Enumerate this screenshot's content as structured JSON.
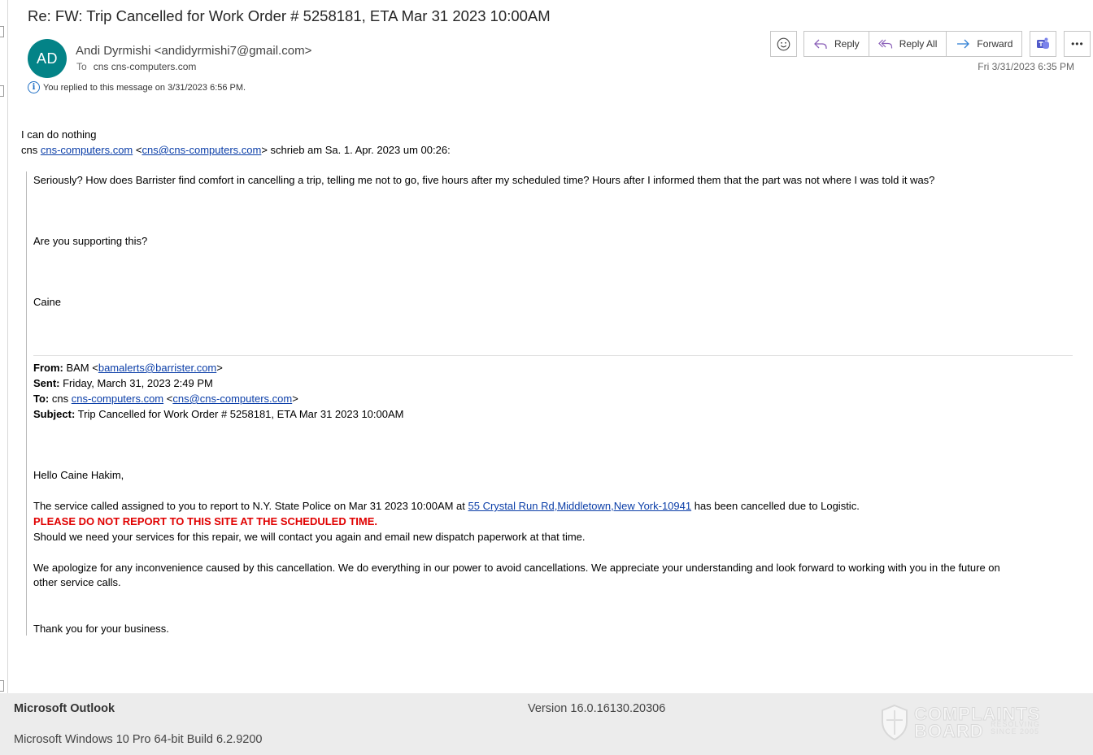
{
  "message": {
    "subject": "Re: FW: Trip Cancelled for Work Order # 5258181, ETA Mar 31 2023 10:00AM",
    "avatar_initials": "AD",
    "sender": "Andi Dyrmishi <andidyrmishi7@gmail.com>",
    "to_label": "To",
    "to_value": "cns cns-computers.com",
    "info_text": "You replied to this message on 3/31/2023 6:56 PM.",
    "date": "Fri 3/31/2023 6:35 PM"
  },
  "toolbar": {
    "emoji_icon": "smiley-icon",
    "reply_label": "Reply",
    "reply_all_label": "Reply All",
    "forward_label": "Forward",
    "teams_icon": "teams-icon",
    "more_icon": "more-icon",
    "more_label": "•••"
  },
  "body": {
    "line1": "I can do nothing",
    "attrib_prefix": "cns ",
    "attrib_link1": "cns-computers.com",
    "attrib_lt": " <",
    "attrib_link2": "cns@cns-computers.com",
    "attrib_suffix": "> schrieb am Sa. 1. Apr. 2023 um 00:26:"
  },
  "quote": {
    "p1": "Seriously? How does Barrister find comfort in cancelling a trip, telling me not to go, five hours after my scheduled time? Hours after I informed them that the part was not where I was told it was?",
    "p2": "Are you supporting this?",
    "p3": "Caine",
    "from_label": "From:",
    "from_name": " BAM <",
    "from_link": "bamalerts@barrister.com",
    "from_end": ">",
    "sent_label": "Sent:",
    "sent_value": " Friday, March 31, 2023 2:49 PM",
    "to_label": "To:",
    "to_prefix": " cns ",
    "to_link1": "cns-computers.com",
    "to_lt": " <",
    "to_link2": "cns@cns-computers.com",
    "to_end": ">",
    "subject_label": "Subject:",
    "subject_value": " Trip Cancelled for Work Order # 5258181, ETA Mar 31 2023 10:00AM",
    "greeting": "Hello Caine Hakim,",
    "service_pre": "The service called assigned to you to report to N.Y. State Police on Mar 31 2023 10:00AM at ",
    "service_link": "55 Crystal Run Rd,Middletown,New York-10941",
    "service_post": " has been cancelled due to Logistic.",
    "warning": "PLEASE DO NOT REPORT TO THIS SITE AT THE SCHEDULED TIME.",
    "contact": "Should we need your services for this repair, we will contact you again and email new dispatch paperwork at that time.",
    "apology1": "We apologize for any inconvenience caused by this cancellation. We do everything in our power to avoid cancellations. We appreciate your understanding and look forward to working with you in the future on",
    "apology2": "other service calls.",
    "thanks": "Thank you for your business."
  },
  "footer": {
    "app": "Microsoft Outlook",
    "version": "Version 16.0.16130.20306",
    "os": "Microsoft Windows 10 Pro 64-bit Build 6.2.9200"
  },
  "watermark": {
    "line1": "COMPLAINTS",
    "line2": "BOARD",
    "tagline": "RESOLVING SINCE 2005"
  }
}
